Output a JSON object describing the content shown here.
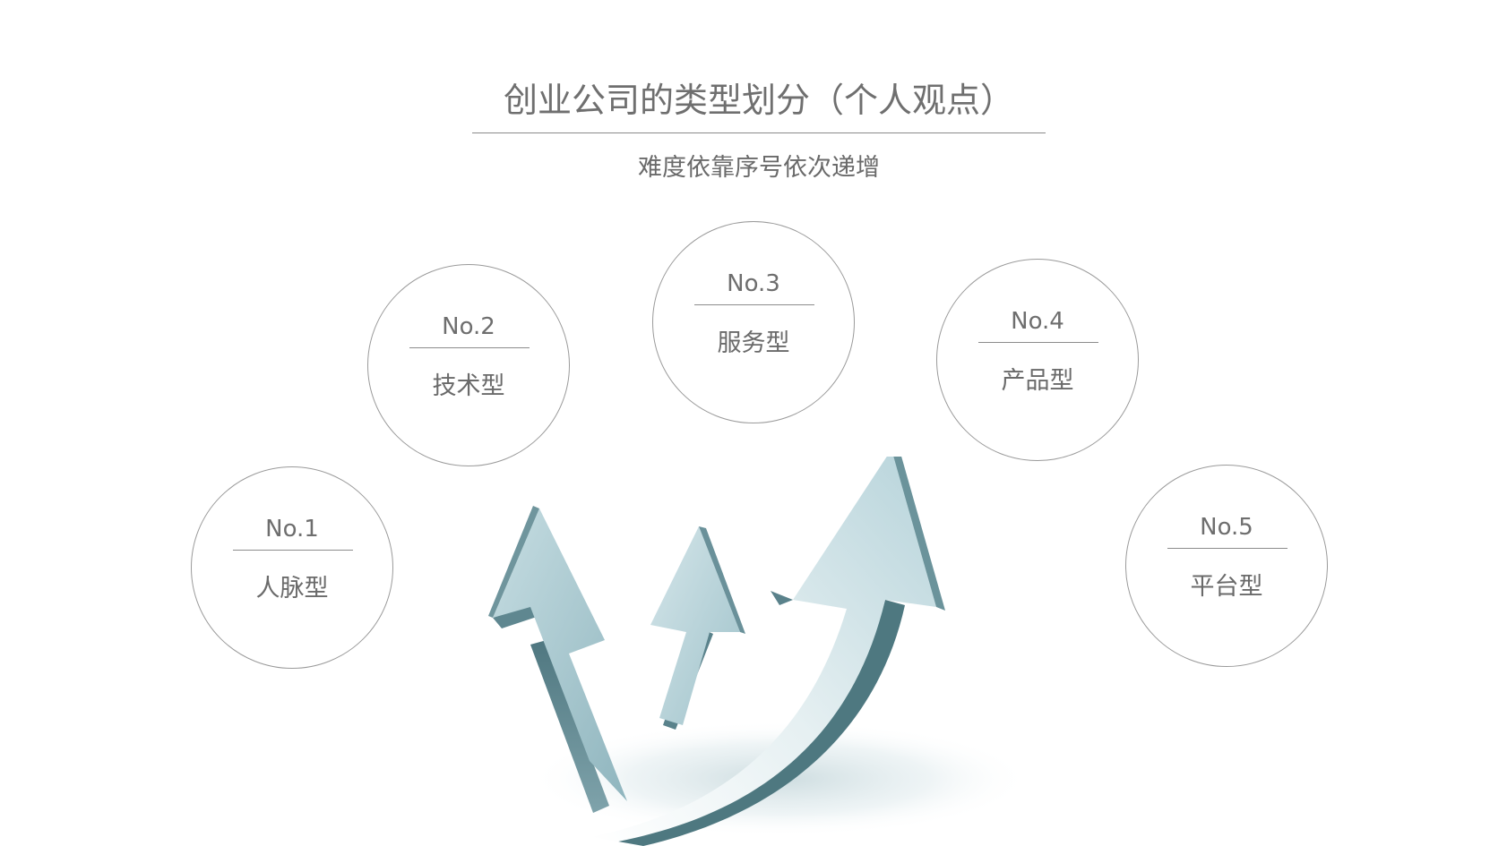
{
  "slide": {
    "title": "创业公司的类型划分（个人观点）",
    "subtitle": "难度依靠序号依次递增"
  },
  "circles": [
    {
      "number": "No.1",
      "label": "人脉型"
    },
    {
      "number": "No.2",
      "label": "技术型"
    },
    {
      "number": "No.3",
      "label": "服务型"
    },
    {
      "number": "No.4",
      "label": "产品型"
    },
    {
      "number": "No.5",
      "label": "平台型"
    }
  ],
  "graphic": {
    "icon": "rising-arrows-icon",
    "arrow_light": "#dcebee",
    "arrow_mid": "#a9c9d0",
    "arrow_dark": "#5f8790",
    "shadow": "#cfdfe3"
  }
}
